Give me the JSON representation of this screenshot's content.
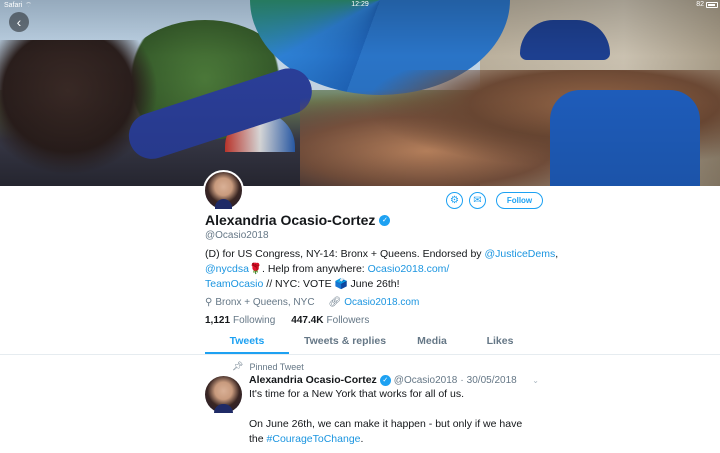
{
  "status_bar": {
    "carrier": "Safari",
    "time": "12:29",
    "battery_pct": "82"
  },
  "profile": {
    "name": "Alexandria Ocasio-Cortez",
    "handle": "@Ocasio2018",
    "bio": {
      "part1": "(D) for US Congress, NY-14: Bronx + Queens. Endorsed by ",
      "mention1": "@JusticeDems",
      "sep1": ", ",
      "mention2": "@nycdsa",
      "part2": "🌹. Help from anywhere: ",
      "link_a": "Ocasio2018.com/",
      "link_b": "TeamOcasio",
      "part3": " // NYC: VOTE 🗳️ June 26th!"
    },
    "location": "Bronx + Queens, NYC",
    "website": "Ocasio2018.com",
    "following_count": "1,121",
    "following_label": "Following",
    "followers_count": "447.4K",
    "followers_label": "Followers"
  },
  "actions": {
    "follow_label": "Follow"
  },
  "tabs": [
    {
      "label": "Tweets",
      "active": true
    },
    {
      "label": "Tweets & replies",
      "active": false
    },
    {
      "label": "Media",
      "active": false
    },
    {
      "label": "Likes",
      "active": false
    }
  ],
  "pinned_tweet": {
    "pinned_label": "Pinned Tweet",
    "name": "Alexandria Ocasio-Cortez",
    "handle": "@Ocasio2018",
    "dot": "·",
    "date": "30/05/2018",
    "text_line1": "It's time for a New York that works for all of us.",
    "text_line2": "On June 26th, we can make it happen - but only if we have",
    "text_line3_prefix": "the ",
    "hashtag": "#CourageToChange",
    "text_line3_suffix": "."
  },
  "icons": {
    "back": "chevron-left-icon",
    "settings": "gear-icon",
    "message": "envelope-icon",
    "verified": "verified-badge-icon",
    "location": "location-pin-icon",
    "link": "link-icon",
    "pin": "pin-icon",
    "more": "chevron-down-icon"
  },
  "colors": {
    "accent": "#1da1f2",
    "link": "#1b95e0",
    "muted": "#657786",
    "text": "#14171a"
  }
}
